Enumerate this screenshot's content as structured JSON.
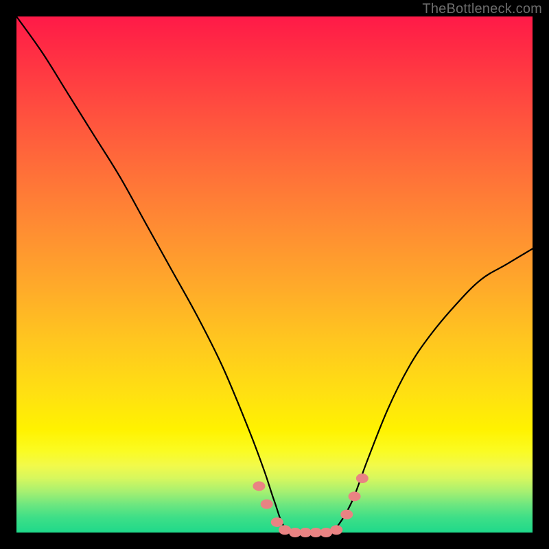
{
  "watermark": "TheBottleneck.com",
  "chart_data": {
    "type": "line",
    "title": "",
    "xlabel": "",
    "ylabel": "",
    "xlim": [
      0,
      100
    ],
    "ylim": [
      0,
      100
    ],
    "grid": false,
    "legend": false,
    "curve_note": "V-shaped bottleneck curve. y ≈ 100 at x=0, drops to ~0 near x≈52–62, rises to ~55 at x=100. Values estimated from pixel positions; no axis ticks are visible.",
    "series": [
      {
        "name": "bottleneck-curve",
        "color": "#000000",
        "x": [
          0,
          5,
          10,
          15,
          20,
          25,
          30,
          35,
          40,
          45,
          48,
          50,
          52,
          55,
          58,
          60,
          62,
          65,
          68,
          72,
          76,
          80,
          85,
          90,
          95,
          100
        ],
        "y": [
          100,
          93,
          85,
          77,
          69,
          60,
          51,
          42,
          32,
          20,
          12,
          6,
          1,
          0,
          0,
          0,
          1,
          6,
          14,
          24,
          32,
          38,
          44,
          49,
          52,
          55
        ]
      }
    ],
    "markers": {
      "name": "highlight-dots",
      "color": "#e98383",
      "note": "Salmon-colored dots/segments near the valley and on the rising slope just above it.",
      "points": [
        {
          "x": 47.0,
          "y": 9.0
        },
        {
          "x": 48.5,
          "y": 5.5
        },
        {
          "x": 50.5,
          "y": 2.0
        },
        {
          "x": 52.0,
          "y": 0.5
        },
        {
          "x": 54.0,
          "y": 0.0
        },
        {
          "x": 56.0,
          "y": 0.0
        },
        {
          "x": 58.0,
          "y": 0.0
        },
        {
          "x": 60.0,
          "y": 0.0
        },
        {
          "x": 62.0,
          "y": 0.5
        },
        {
          "x": 64.0,
          "y": 3.5
        },
        {
          "x": 65.5,
          "y": 7.0
        },
        {
          "x": 67.0,
          "y": 10.5
        }
      ]
    }
  }
}
